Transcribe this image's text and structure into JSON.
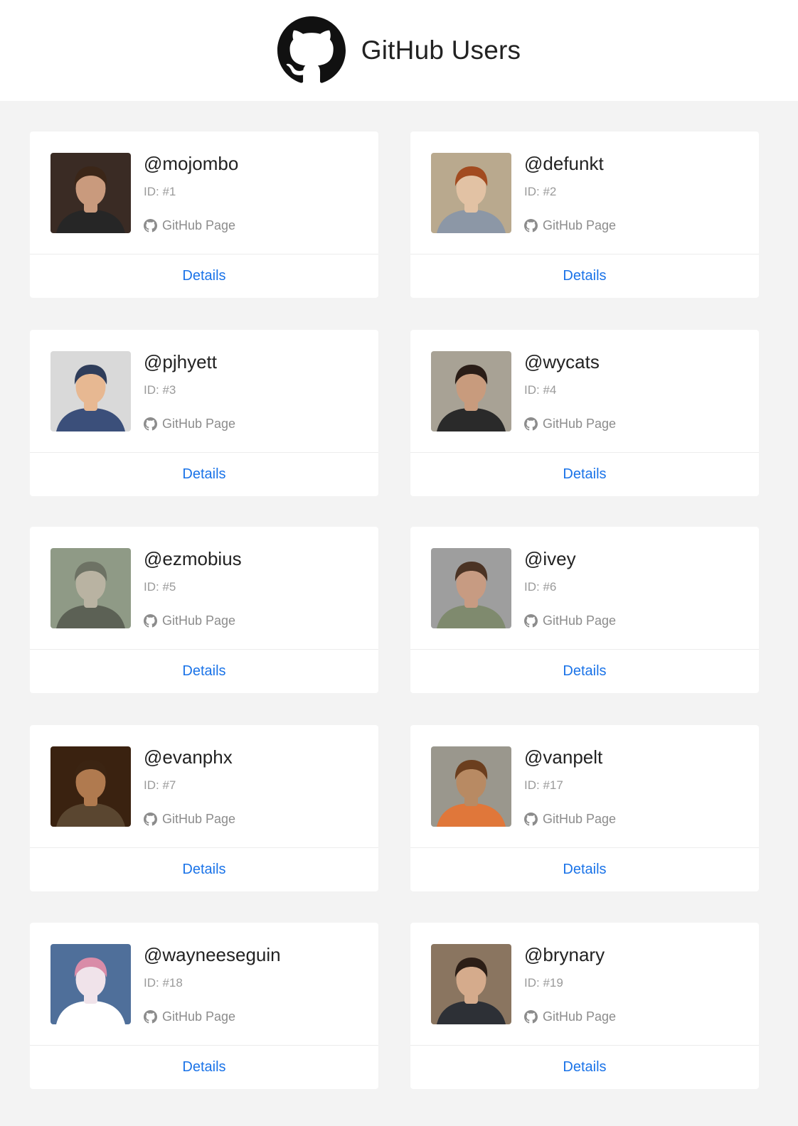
{
  "header": {
    "title": "GitHub Users",
    "logo_icon": "github-octocat-icon"
  },
  "users": [
    {
      "username": "@mojombo",
      "id": "ID: #1",
      "link_label": "GitHub Page",
      "details_label": "Details",
      "palette": {
        "bg": "#3a2b24",
        "skin": "#c99a7d",
        "hair": "#3b2618",
        "shirt": "#262626"
      }
    },
    {
      "username": "@defunkt",
      "id": "ID: #2",
      "link_label": "GitHub Page",
      "details_label": "Details",
      "palette": {
        "bg": "#b9a98e",
        "skin": "#e2c2a4",
        "hair": "#a24b20",
        "shirt": "#8c97a6"
      }
    },
    {
      "username": "@pjhyett",
      "id": "ID: #3",
      "link_label": "GitHub Page",
      "details_label": "Details",
      "palette": {
        "bg": "#d9d9d9",
        "skin": "#e7b892",
        "hair": "#2f3d5a",
        "shirt": "#3b4f7a"
      }
    },
    {
      "username": "@wycats",
      "id": "ID: #4",
      "link_label": "GitHub Page",
      "details_label": "Details",
      "palette": {
        "bg": "#a8a295",
        "skin": "#c89b7d",
        "hair": "#2a1d17",
        "shirt": "#2a2a2a"
      }
    },
    {
      "username": "@ezmobius",
      "id": "ID: #5",
      "link_label": "GitHub Page",
      "details_label": "Details",
      "palette": {
        "bg": "#8f9a86",
        "skin": "#b9b3a2",
        "hair": "#6d7264",
        "shirt": "#5c6155"
      }
    },
    {
      "username": "@ivey",
      "id": "ID: #6",
      "link_label": "GitHub Page",
      "details_label": "Details",
      "palette": {
        "bg": "#9e9e9e",
        "skin": "#c79b82",
        "hair": "#4b3324",
        "shirt": "#7f8a6e"
      }
    },
    {
      "username": "@evanphx",
      "id": "ID: #7",
      "link_label": "GitHub Page",
      "details_label": "Details",
      "palette": {
        "bg": "#3a2210",
        "skin": "#b07a4f",
        "hair": "#3b2412",
        "shirt": "#5a4630"
      }
    },
    {
      "username": "@vanpelt",
      "id": "ID: #17",
      "link_label": "GitHub Page",
      "details_label": "Details",
      "palette": {
        "bg": "#9a978d",
        "skin": "#b88a63",
        "hair": "#6b3e1e",
        "shirt": "#e0773a"
      }
    },
    {
      "username": "@wayneeseguin",
      "id": "ID: #18",
      "link_label": "GitHub Page",
      "details_label": "Details",
      "palette": {
        "bg": "#4f6f9a",
        "skin": "#f0e3ea",
        "hair": "#d98ca8",
        "shirt": "#ffffff"
      }
    },
    {
      "username": "@brynary",
      "id": "ID: #19",
      "link_label": "GitHub Page",
      "details_label": "Details",
      "palette": {
        "bg": "#8a7560",
        "skin": "#d5ab8c",
        "hair": "#2c1e16",
        "shirt": "#2d3036"
      }
    }
  ]
}
